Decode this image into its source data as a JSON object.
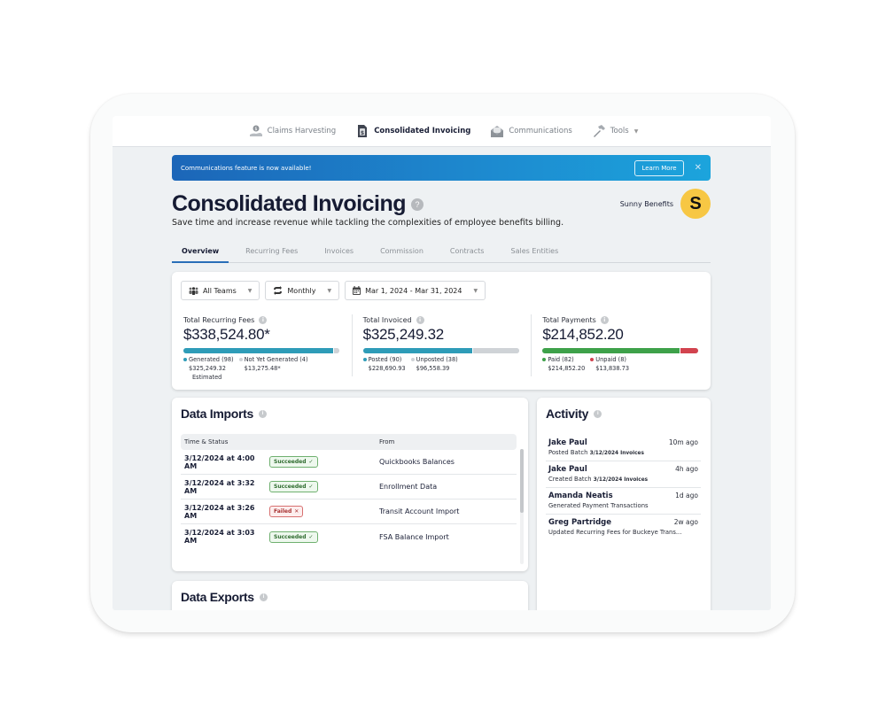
{
  "topnav": {
    "items": [
      {
        "label": "Claims Harvesting",
        "icon": "hand-coin-icon",
        "active": false
      },
      {
        "label": "Consolidated Invoicing",
        "icon": "invoice-dollar-icon",
        "active": true
      },
      {
        "label": "Communications",
        "icon": "envelope-open-icon",
        "active": false
      },
      {
        "label": "Tools",
        "icon": "hammer-icon",
        "active": false,
        "caret": "▼"
      }
    ]
  },
  "banner": {
    "message": "Communications feature is now available!",
    "cta": "Learn More",
    "close": "✕"
  },
  "header": {
    "title": "Consolidated Invoicing",
    "help": "?",
    "subtitle": "Save time and increase revenue while tackling the complexities of employee benefits billing.",
    "company": "Sunny Benefits",
    "avatar_letter": "S",
    "avatar_color": "#f7c744"
  },
  "tabs": [
    {
      "label": "Overview",
      "active": true
    },
    {
      "label": "Recurring Fees",
      "active": false
    },
    {
      "label": "Invoices",
      "active": false
    },
    {
      "label": "Commission",
      "active": false
    },
    {
      "label": "Contracts",
      "active": false
    },
    {
      "label": "Sales Entities",
      "active": false
    }
  ],
  "filters": {
    "team": "All Teams",
    "period": "Monthly",
    "date_range": "Mar 1, 2024 - Mar 31, 2024",
    "dropdown": "▼"
  },
  "metrics": [
    {
      "label": "Total Recurring Fees",
      "value": "$338,524.80*",
      "segments": [
        {
          "label": "Generated (98)",
          "amount": "$325,249.32",
          "note": "Estimated",
          "fraction": 0.96,
          "color": "#2e9cb8"
        },
        {
          "label": "Not Yet Generated (4)",
          "amount": "$13,275.48*",
          "fraction": 0.04,
          "color": "#cfd3d7"
        }
      ]
    },
    {
      "label": "Total Invoiced",
      "value": "$325,249.32",
      "segments": [
        {
          "label": "Posted (90)",
          "amount": "$228,690.93",
          "fraction": 0.7,
          "color": "#2e9cb8"
        },
        {
          "label": "Unposted (38)",
          "amount": "$96,558.39",
          "fraction": 0.3,
          "color": "#cfd3d7"
        }
      ]
    },
    {
      "label": "Total Payments",
      "value": "$214,852.20",
      "segments": [
        {
          "label": "Paid (82)",
          "amount": "$214,852.20",
          "fraction": 0.88,
          "color": "#3ea14a"
        },
        {
          "label": "Unpaid (8)",
          "amount": "$13,838.73",
          "fraction": 0.12,
          "color": "#d2434e"
        }
      ]
    }
  ],
  "imports": {
    "title": "Data Imports",
    "columns": [
      "Time & Status",
      "From"
    ],
    "rows": [
      {
        "time": "3/12/2024 at 4:00 AM",
        "status": "Succeeded",
        "status_icon": "✓",
        "ok": true,
        "from": "Quickbooks Balances"
      },
      {
        "time": "3/12/2024 at 3:32 AM",
        "status": "Succeeded",
        "status_icon": "✓",
        "ok": true,
        "from": "Enrollment Data"
      },
      {
        "time": "3/12/2024 at 3:26 AM",
        "status": "Failed",
        "status_icon": "✕",
        "ok": false,
        "from": "Transit Account Import"
      },
      {
        "time": "3/12/2024 at 3:03 AM",
        "status": "Succeeded",
        "status_icon": "✓",
        "ok": true,
        "from": "FSA Balance Import"
      }
    ]
  },
  "exports": {
    "title": "Data Exports"
  },
  "activity": {
    "title": "Activity",
    "items": [
      {
        "name": "Jake Paul",
        "time": "10m ago",
        "desc": "Posted Batch ",
        "desc_bold": "3/12/2024 Invoices"
      },
      {
        "name": "Jake Paul",
        "time": "4h ago",
        "desc": "Created Batch ",
        "desc_bold": "3/12/2024 Invoices"
      },
      {
        "name": "Amanda Neatis",
        "time": "1d ago",
        "desc": "Generated Payment Transactions",
        "desc_bold": ""
      },
      {
        "name": "Greg Partridge",
        "time": "2w ago",
        "desc": "Updated Recurring Fees for Buckeye Trans...",
        "desc_bold": ""
      }
    ]
  },
  "info_glyph": "i"
}
